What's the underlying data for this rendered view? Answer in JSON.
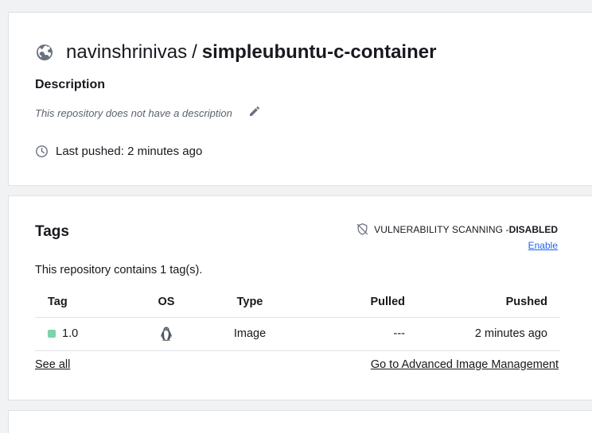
{
  "repository": {
    "owner": "navinshrinivas",
    "separator": "/",
    "name": "simpleubuntu-c-container",
    "visibility_icon": "globe-icon",
    "description_heading": "Description",
    "description_text": "This repository does not have a description",
    "last_pushed": "Last pushed: 2 minutes ago"
  },
  "tags_section": {
    "heading": "Tags",
    "vulnerability_label": "VULNERABILITY SCANNING - ",
    "vulnerability_status": "DISABLED",
    "enable_link": "Enable",
    "count_text": "This repository contains 1 tag(s).",
    "columns": [
      "Tag",
      "OS",
      "Type",
      "Pulled",
      "Pushed"
    ],
    "rows": [
      {
        "tag": "1.0",
        "os_icon": "linux-icon",
        "type": "Image",
        "pulled": "---",
        "pushed": "2 minutes ago"
      }
    ],
    "see_all": "See all",
    "advanced_link": "Go to Advanced Image Management"
  },
  "colors": {
    "link_blue": "#1d63ed",
    "tag_dot": "#7dd3ac",
    "background": "#f1f2f3"
  }
}
